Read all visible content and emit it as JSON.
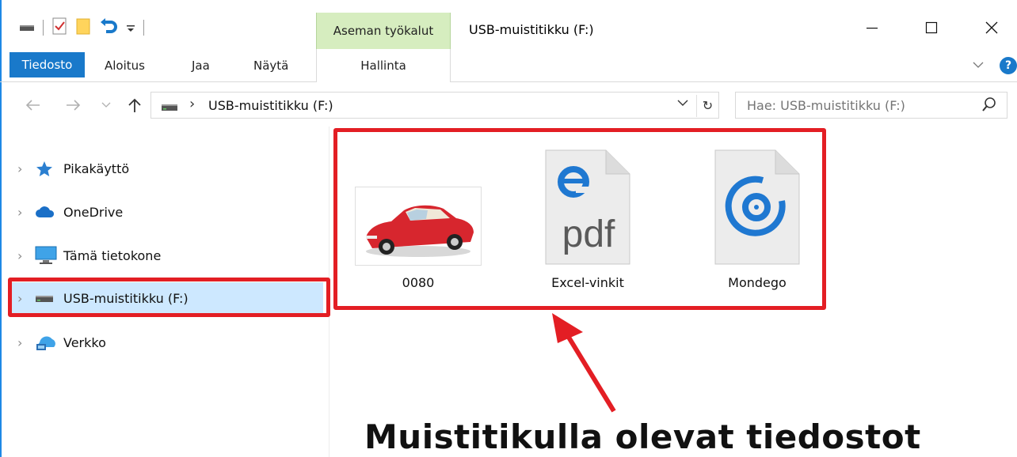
{
  "window": {
    "title": "USB-muistitikku (F:)",
    "contextual_tab_group": "Aseman työkalut"
  },
  "ribbon": {
    "tabs": [
      "Tiedosto",
      "Aloitus",
      "Jaa",
      "Näytä",
      "Hallinta"
    ],
    "active_tab": "Tiedosto",
    "help_label": "?"
  },
  "address": {
    "path": "USB-muistitikku (F:)",
    "search_placeholder": "Hae: USB-muistitikku (F:)"
  },
  "nav_pane": {
    "items": [
      {
        "label": "Pikakäyttö",
        "icon": "star-icon"
      },
      {
        "label": "OneDrive",
        "icon": "cloud-icon"
      },
      {
        "label": "Tämä tietokone",
        "icon": "computer-icon"
      },
      {
        "label": "USB-muistitikku (F:)",
        "icon": "drive-icon",
        "selected": true
      },
      {
        "label": "Verkko",
        "icon": "network-icon"
      }
    ]
  },
  "files": [
    {
      "name": "0080",
      "type": "image",
      "icon": "car-photo-thumbnail"
    },
    {
      "name": "Excel-vinkit",
      "type": "pdf",
      "icon": "edge-pdf-icon",
      "badge_text": "pdf"
    },
    {
      "name": "Mondego",
      "type": "media",
      "icon": "groove-music-icon"
    }
  ],
  "annotation": {
    "caption": "Muistitikulla olevat tiedostot",
    "highlight_color": "#e31e24"
  },
  "colors": {
    "accent": "#1979ca",
    "tools_tab": "#d6edbf",
    "selection": "#cde8ff"
  }
}
